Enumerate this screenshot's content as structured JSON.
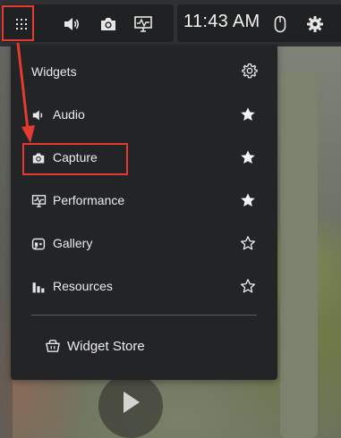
{
  "topbar": {
    "icons": [
      "widgets-grid-icon",
      "speaker-icon",
      "camera-icon",
      "performance-monitor-icon"
    ],
    "clock": "11:43 AM",
    "right_icons": [
      "mouse-icon",
      "settings-gear-icon"
    ]
  },
  "menu": {
    "title": "Widgets",
    "items": [
      {
        "label": "Audio",
        "icon": "speaker-icon",
        "favorite": true
      },
      {
        "label": "Capture",
        "icon": "camera-icon",
        "favorite": true
      },
      {
        "label": "Performance",
        "icon": "performance-monitor-icon",
        "favorite": true
      },
      {
        "label": "Gallery",
        "icon": "gallery-icon",
        "favorite": false
      },
      {
        "label": "Resources",
        "icon": "resources-bars-icon",
        "favorite": false
      }
    ],
    "store_label": "Widget Store"
  },
  "annotations": {
    "highlight_color": "#e53a2f",
    "highlighted": [
      "widgets-grid-button",
      "menu-item-capture"
    ]
  }
}
